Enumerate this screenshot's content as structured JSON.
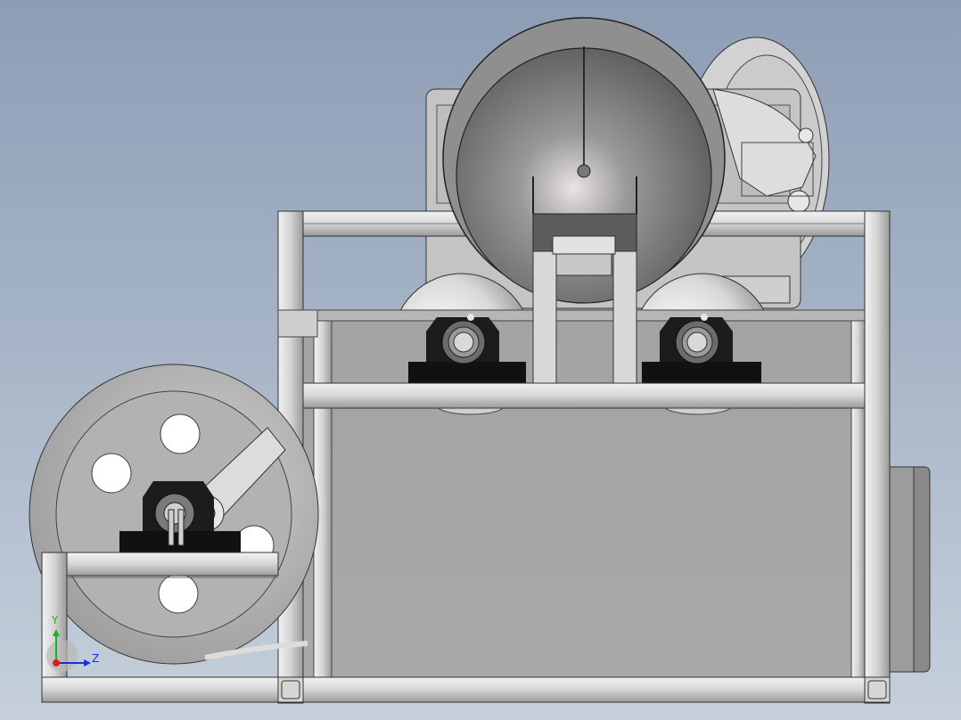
{
  "viewport": {
    "background_top": "#8d9db4",
    "background_bottom": "#c6d0dc"
  },
  "model": {
    "colors": {
      "metal_light": "#dcdcdc",
      "metal_mid": "#a9a9a9",
      "metal_dark": "#6a6a6a",
      "bearing_block": "#1c1c1c",
      "edge": "#2a2a2a"
    }
  },
  "triad": {
    "y_label": "Y",
    "z_label": "Z",
    "y_color": "#1bb31b",
    "z_color": "#1f2fd6",
    "x_color": "#d42020"
  }
}
